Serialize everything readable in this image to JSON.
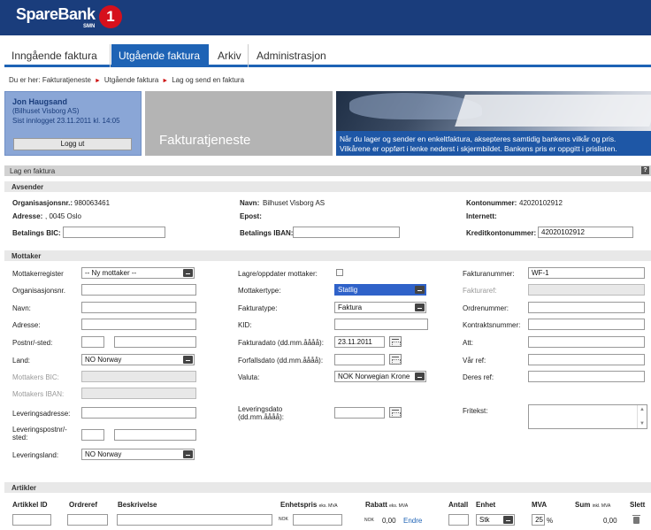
{
  "brand": {
    "name": "SpareBank",
    "sub": "SMN",
    "number": "1"
  },
  "tabs": [
    "Inngående faktura",
    "Utgående faktura",
    "Arkiv",
    "Administrasjon"
  ],
  "breadcrumb": {
    "prefix": "Du er her:",
    "items": [
      "Fakturatjeneste",
      "Utgående faktura",
      "Lag og send en faktura"
    ]
  },
  "user": {
    "name": "Jon Haugsand",
    "company": "(Bilhuset Visborg AS)",
    "last_login": "Sist innlogget 23.11.2011 kl. 14:05",
    "logout": "Logg ut"
  },
  "banner": {
    "title": "Fakturatjeneste",
    "caption_line1": "Når du lager og sender en enkeltfaktura, aksepteres samtidig bankens vilkår og pris.",
    "caption_line2": "Vilkårene er oppført i lenke nederst i skjermbildet. Bankens pris er oppgitt i prislisten."
  },
  "form": {
    "title": "Lag en faktura",
    "help": "?"
  },
  "avsender": {
    "header": "Avsender",
    "orgnr_label": "Organisasjonsnr.:",
    "orgnr": "980063461",
    "adresse_label": "Adresse:",
    "adresse": ", 0045 Oslo",
    "bic_label": "Betalings BIC:",
    "navn_label": "Navn:",
    "navn": "Bilhuset Visborg AS",
    "epost_label": "Epost:",
    "iban_label": "Betalings IBAN:",
    "konto_label": "Kontonummer:",
    "konto": "42020102912",
    "internett_label": "Internett:",
    "kredit_label": "Kreditkontonummer:",
    "kredit": "42020102912"
  },
  "mottaker": {
    "header": "Mottaker",
    "register_label": "Mottakerregister",
    "register": "-- Ny mottaker --",
    "orgnr_label": "Organisasjonsnr.",
    "navn_label": "Navn:",
    "adresse_label": "Adresse:",
    "postnr_label": "Postnr/-sted:",
    "land_label": "Land:",
    "land": "NO Norway",
    "bic_label": "Mottakers BIC:",
    "iban_label": "Mottakers IBAN:",
    "lev_adresse_label": "Leveringsadresse:",
    "lev_postnr_label": "Leveringspostnr/-sted:",
    "lev_land_label": "Leveringsland:",
    "lev_land": "NO Norway",
    "lagre_label": "Lagre/oppdater mottaker:",
    "type_label": "Mottakertype:",
    "type": "Statlig",
    "fakturatype_label": "Fakturatype:",
    "fakturatype": "Faktura",
    "kid_label": "KID:",
    "fakturadato_label": "Fakturadato (dd.mm.åååå):",
    "fakturadato": "23.11.2011",
    "forfall_label": "Forfallsdato (dd.mm.åååå):",
    "valuta_label": "Valuta:",
    "valuta": "NOK Norwegian Krone",
    "levdato_label": "Leveringsdato (dd.mm.åååå):",
    "fakturanr_label": "Fakturanummer:",
    "fakturanr": "WF-1",
    "fakturaref_label": "Fakturaref:",
    "ordrenr_label": "Ordrenummer:",
    "kontrakt_label": "Kontraktsnummer:",
    "att_label": "Att:",
    "var_ref_label": "Vår ref:",
    "deres_ref_label": "Deres ref:",
    "fritekst_label": "Fritekst:"
  },
  "artikler": {
    "header": "Artikler",
    "cols": {
      "id": "Artikkel ID",
      "ordreref": "Ordreref",
      "beskrivelse": "Beskrivelse",
      "enhetspris": "Enhetspris",
      "enhetspris_sub": "eks. MVA",
      "rabatt": "Rabatt",
      "rabatt_sub": "eks. MVA",
      "antall": "Antall",
      "enhet": "Enhet",
      "mva": "MVA",
      "sum": "Sum",
      "sum_sub": "inkl. MVA",
      "slett": "Slett"
    },
    "row": {
      "currency": "NOK",
      "rabatt_currency": "NOK",
      "rabatt": "0,00",
      "endre": "Endre",
      "enhet": "Stk",
      "mva": "25",
      "mva_unit": "%",
      "sum": "0,00"
    }
  }
}
